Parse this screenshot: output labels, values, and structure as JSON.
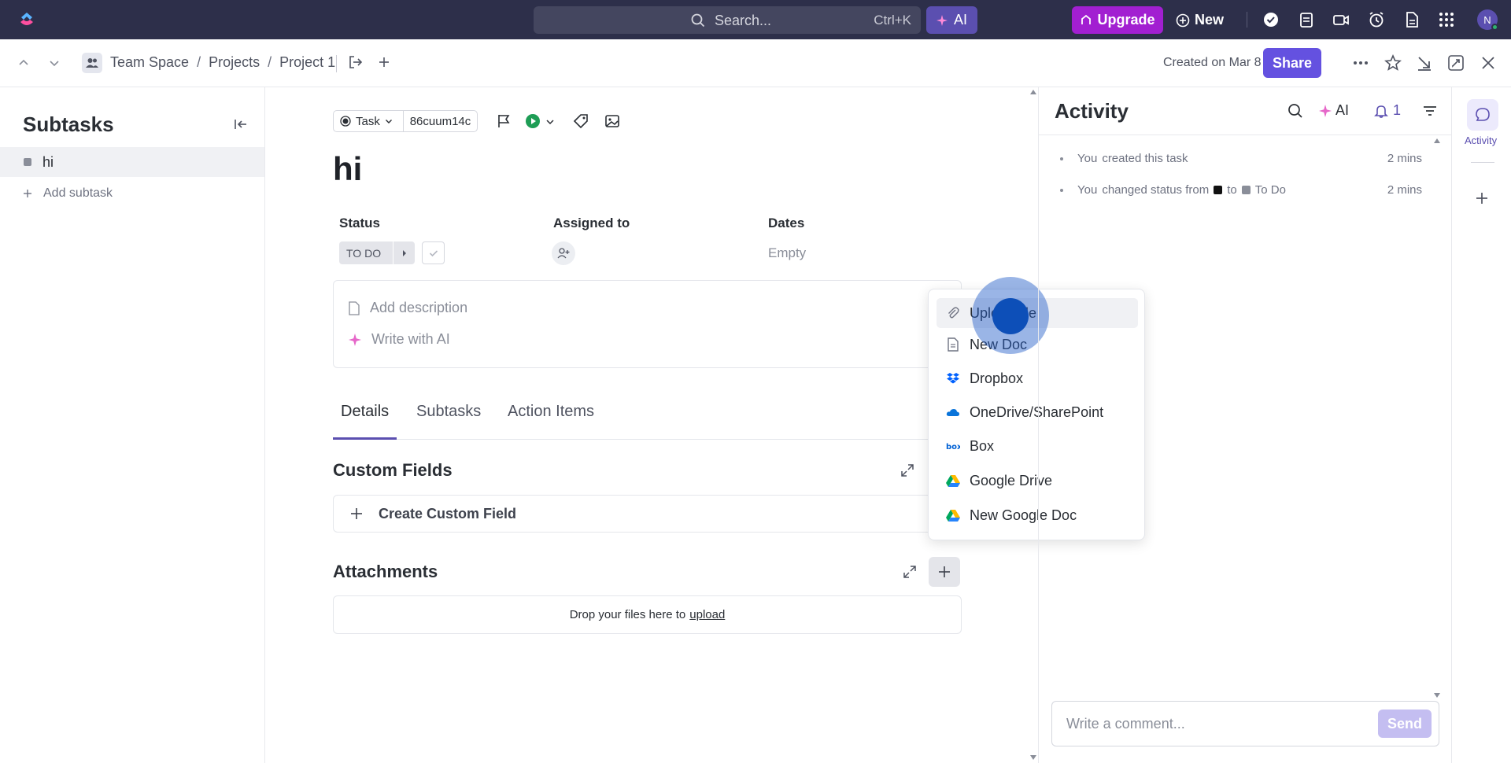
{
  "topbar": {
    "search_placeholder": "Search...",
    "search_shortcut": "Ctrl+K",
    "ai_label": "AI",
    "upgrade_label": "Upgrade",
    "new_label": "New",
    "avatar_initial": "N"
  },
  "breadcrumb": {
    "items": [
      "Team Space",
      "Projects",
      "Project 1"
    ],
    "separator": "/",
    "created": "Created on Mar 8",
    "share_label": "Share"
  },
  "sidebar": {
    "title": "Subtasks",
    "items": [
      {
        "label": "hi"
      }
    ],
    "add_label": "Add subtask"
  },
  "task": {
    "type_label": "Task",
    "id": "86cuum14c",
    "title": "hi",
    "status_label": "Status",
    "status_value": "TO DO",
    "assigned_label": "Assigned to",
    "dates_label": "Dates",
    "dates_value": "Empty",
    "add_description": "Add description",
    "write_ai": "Write with AI",
    "tabs": [
      {
        "label": "Details"
      },
      {
        "label": "Subtasks"
      },
      {
        "label": "Action Items"
      }
    ],
    "custom_fields_title": "Custom Fields",
    "create_custom_field": "Create Custom Field",
    "attachments_title": "Attachments",
    "drop_text": "Drop your files here to",
    "drop_link": "upload"
  },
  "dropdown": {
    "items": [
      {
        "label": "Upload file",
        "icon": "paperclip-icon"
      },
      {
        "label": "New Doc",
        "icon": "doc-icon"
      },
      {
        "label": "Dropbox",
        "icon": "dropbox-icon"
      },
      {
        "label": "OneDrive/SharePoint",
        "icon": "onedrive-icon"
      },
      {
        "label": "Box",
        "icon": "box-icon"
      },
      {
        "label": "Google Drive",
        "icon": "google-drive-icon"
      },
      {
        "label": "New Google Doc",
        "icon": "google-drive-icon"
      }
    ]
  },
  "activity": {
    "title": "Activity",
    "ai_label": "AI",
    "notif_count": "1",
    "entries": [
      {
        "actor": "You",
        "text": "created this task",
        "time": "2 mins"
      },
      {
        "actor": "You",
        "text": "changed status from",
        "to_word": "to",
        "to_status": "To Do",
        "time": "2 mins"
      }
    ],
    "comment_placeholder": "Write a comment...",
    "send_label": "Send"
  },
  "rail": {
    "activity_label": "Activity"
  },
  "colors": {
    "topbar_bg": "#2d2f4a",
    "accent": "#5b4fb0",
    "share": "#6451e0",
    "upgrade": "#a21fd1"
  }
}
